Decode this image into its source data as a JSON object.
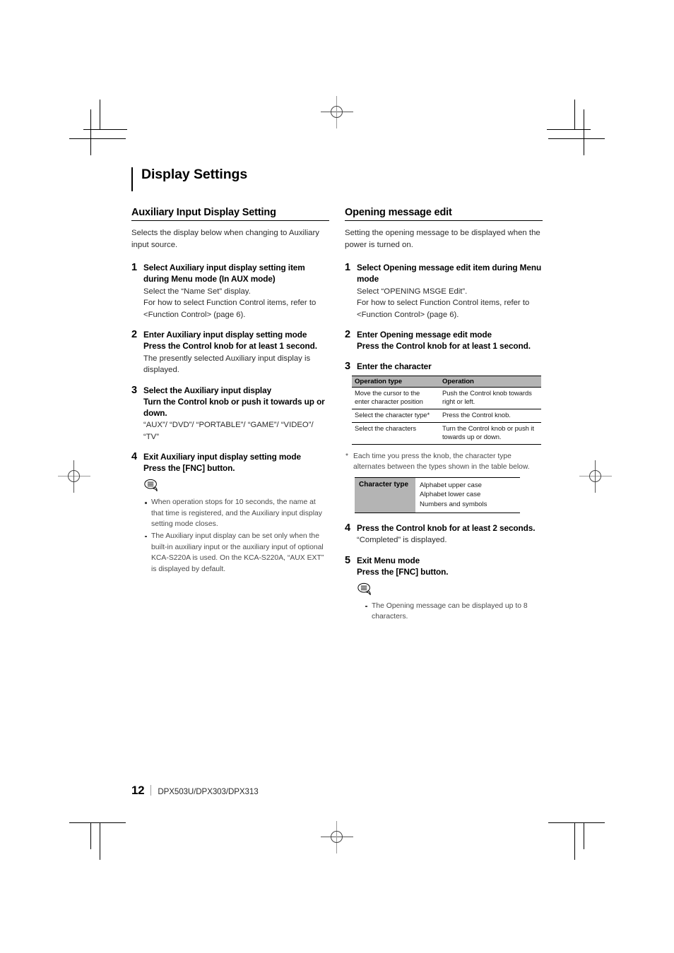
{
  "chapter": {
    "title": "Display Settings"
  },
  "footer": {
    "page_number": "12",
    "models": "DPX503U/DPX303/DPX313"
  },
  "left_column": {
    "section_title": "Auxiliary Input Display Setting",
    "intro": "Selects the display below when changing to Auxiliary input source.",
    "steps": [
      {
        "num": "1",
        "title": "Select Auxiliary input display setting item during Menu mode (In AUX mode)",
        "body": "Select the “Name Set” display.\nFor how to select Function Control items, refer to <Function Control> (page 6)."
      },
      {
        "num": "2",
        "title": "Enter Auxiliary input display setting mode",
        "subtitle": "Press the Control knob for at least 1 second.",
        "body": "The presently selected Auxiliary input display is displayed."
      },
      {
        "num": "3",
        "title": "Select the Auxiliary input display",
        "subtitle": "Turn the Control knob or push it towards up or down.",
        "body": "“AUX”/ “DVD”/ “PORTABLE”/ “GAME”/ “VIDEO”/ “TV”"
      },
      {
        "num": "4",
        "title": "Exit Auxiliary input display setting mode",
        "subtitle": "Press the [FNC] button."
      }
    ],
    "notes": [
      "When operation stops for 10 seconds, the name at that time is registered, and the Auxiliary input display setting mode closes.",
      "The Auxiliary input display can be set only when the built-in auxiliary input or the auxiliary input of optional KCA-S220A is used. On the KCA-S220A, “AUX EXT” is displayed by default."
    ]
  },
  "right_column": {
    "section_title": "Opening message edit",
    "intro": "Setting the opening message to be displayed when the power is turned on.",
    "steps": [
      {
        "num": "1",
        "title": "Select Opening message edit item during Menu mode",
        "body": "Select “OPENING MSGE Edit”.\nFor how to select Function Control items, refer to <Function Control> (page 6)."
      },
      {
        "num": "2",
        "title": "Enter Opening message edit mode",
        "subtitle": "Press the Control knob for at least 1 second."
      },
      {
        "num": "3",
        "title": "Enter the character"
      },
      {
        "num": "4",
        "title": "Press the Control knob for at least 2 seconds.",
        "body": "“Completed” is displayed."
      },
      {
        "num": "5",
        "title": "Exit Menu mode",
        "subtitle": "Press the [FNC] button."
      }
    ],
    "operation_table": {
      "headers": [
        "Operation type",
        "Operation"
      ],
      "rows": [
        [
          "Move the cursor to the enter character position",
          "Push the Control knob towards right or left."
        ],
        [
          "Select the character type*",
          "Press the Control knob."
        ],
        [
          "Select the characters",
          "Turn the Control knob or push it towards up or down."
        ]
      ]
    },
    "footnote": {
      "marker": "*",
      "text": "Each time you press the knob, the character type alternates between the types shown in the table below."
    },
    "character_type_table": {
      "header": "Character type",
      "values": "Alphabet upper case\nAlphabet lower case\nNumbers and symbols"
    },
    "notes": [
      "The Opening message can be displayed up to 8 characters."
    ]
  }
}
